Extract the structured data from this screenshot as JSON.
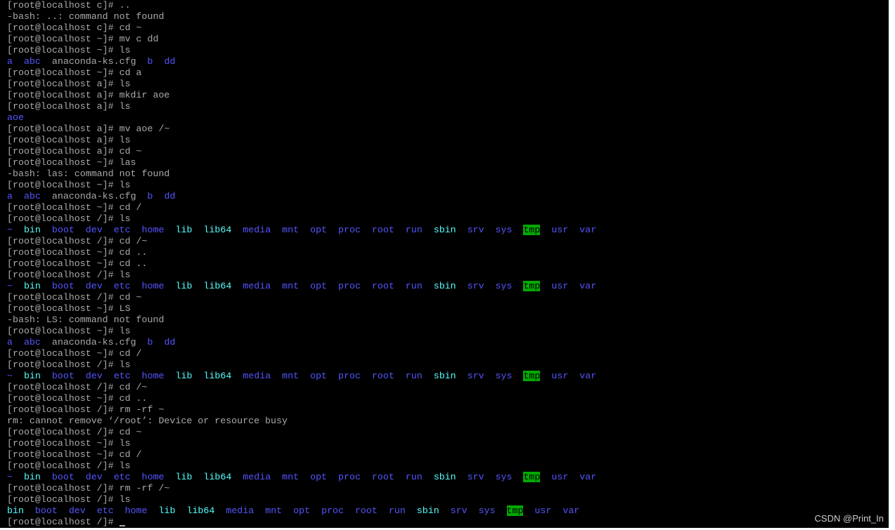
{
  "terminal": {
    "colors": {
      "background": "#000000",
      "text": "#aaaaaa",
      "directory": "#5555ff",
      "directory_highlight": "#55ffff",
      "sticky_dir_bg": "#00aa00"
    },
    "lines": [
      [
        {
          "t": "[root@localhost c]# .."
        }
      ],
      [
        {
          "t": "-bash: ..: command not found"
        }
      ],
      [
        {
          "t": "[root@localhost c]# cd ~"
        }
      ],
      [
        {
          "t": "[root@localhost ~]# mv c dd"
        }
      ],
      [
        {
          "t": "[root@localhost ~]# ls"
        }
      ],
      [
        {
          "t": "a",
          "c": "dir"
        },
        {
          "t": "  "
        },
        {
          "t": "abc",
          "c": "dir"
        },
        {
          "t": "  anaconda-ks.cfg  "
        },
        {
          "t": "b",
          "c": "dir"
        },
        {
          "t": "  "
        },
        {
          "t": "dd",
          "c": "dir"
        }
      ],
      [
        {
          "t": "[root@localhost ~]# cd a"
        }
      ],
      [
        {
          "t": "[root@localhost a]# ls"
        }
      ],
      [
        {
          "t": "[root@localhost a]# mkdir aoe"
        }
      ],
      [
        {
          "t": "[root@localhost a]# ls"
        }
      ],
      [
        {
          "t": "aoe",
          "c": "dir"
        }
      ],
      [
        {
          "t": "[root@localhost a]# mv aoe /~"
        }
      ],
      [
        {
          "t": "[root@localhost a]# ls"
        }
      ],
      [
        {
          "t": "[root@localhost a]# cd ~"
        }
      ],
      [
        {
          "t": "[root@localhost ~]# las"
        }
      ],
      [
        {
          "t": "-bash: las: command not found"
        }
      ],
      [
        {
          "t": "[root@localhost ~]# ls"
        }
      ],
      [
        {
          "t": "a",
          "c": "dir"
        },
        {
          "t": "  "
        },
        {
          "t": "abc",
          "c": "dir"
        },
        {
          "t": "  anaconda-ks.cfg  "
        },
        {
          "t": "b",
          "c": "dir"
        },
        {
          "t": "  "
        },
        {
          "t": "dd",
          "c": "dir"
        }
      ],
      [
        {
          "t": "[root@localhost ~]# cd /"
        }
      ],
      [
        {
          "t": "[root@localhost /]# ls"
        }
      ],
      [
        {
          "t": "~",
          "c": "dir"
        },
        {
          "t": "  "
        },
        {
          "t": "bin",
          "c": "dir-hl"
        },
        {
          "t": "  "
        },
        {
          "t": "boot",
          "c": "dir"
        },
        {
          "t": "  "
        },
        {
          "t": "dev",
          "c": "dir"
        },
        {
          "t": "  "
        },
        {
          "t": "etc",
          "c": "dir"
        },
        {
          "t": "  "
        },
        {
          "t": "home",
          "c": "dir"
        },
        {
          "t": "  "
        },
        {
          "t": "lib",
          "c": "dir-hl"
        },
        {
          "t": "  "
        },
        {
          "t": "lib64",
          "c": "dir-hl"
        },
        {
          "t": "  "
        },
        {
          "t": "media",
          "c": "dir"
        },
        {
          "t": "  "
        },
        {
          "t": "mnt",
          "c": "dir"
        },
        {
          "t": "  "
        },
        {
          "t": "opt",
          "c": "dir"
        },
        {
          "t": "  "
        },
        {
          "t": "proc",
          "c": "dir"
        },
        {
          "t": "  "
        },
        {
          "t": "root",
          "c": "dir"
        },
        {
          "t": "  "
        },
        {
          "t": "run",
          "c": "dir"
        },
        {
          "t": "  "
        },
        {
          "t": "sbin",
          "c": "dir-hl"
        },
        {
          "t": "  "
        },
        {
          "t": "srv",
          "c": "dir"
        },
        {
          "t": "  "
        },
        {
          "t": "sys",
          "c": "dir"
        },
        {
          "t": "  "
        },
        {
          "t": "tmp",
          "c": "tmp-dir"
        },
        {
          "t": "  "
        },
        {
          "t": "usr",
          "c": "dir"
        },
        {
          "t": "  "
        },
        {
          "t": "var",
          "c": "dir"
        }
      ],
      [
        {
          "t": "[root@localhost /]# cd /~"
        }
      ],
      [
        {
          "t": "[root@localhost ~]# cd .."
        }
      ],
      [
        {
          "t": "[root@localhost ~]# cd .."
        }
      ],
      [
        {
          "t": "[root@localhost /]# ls"
        }
      ],
      [
        {
          "t": "~",
          "c": "dir"
        },
        {
          "t": "  "
        },
        {
          "t": "bin",
          "c": "dir-hl"
        },
        {
          "t": "  "
        },
        {
          "t": "boot",
          "c": "dir"
        },
        {
          "t": "  "
        },
        {
          "t": "dev",
          "c": "dir"
        },
        {
          "t": "  "
        },
        {
          "t": "etc",
          "c": "dir"
        },
        {
          "t": "  "
        },
        {
          "t": "home",
          "c": "dir"
        },
        {
          "t": "  "
        },
        {
          "t": "lib",
          "c": "dir-hl"
        },
        {
          "t": "  "
        },
        {
          "t": "lib64",
          "c": "dir-hl"
        },
        {
          "t": "  "
        },
        {
          "t": "media",
          "c": "dir"
        },
        {
          "t": "  "
        },
        {
          "t": "mnt",
          "c": "dir"
        },
        {
          "t": "  "
        },
        {
          "t": "opt",
          "c": "dir"
        },
        {
          "t": "  "
        },
        {
          "t": "proc",
          "c": "dir"
        },
        {
          "t": "  "
        },
        {
          "t": "root",
          "c": "dir"
        },
        {
          "t": "  "
        },
        {
          "t": "run",
          "c": "dir"
        },
        {
          "t": "  "
        },
        {
          "t": "sbin",
          "c": "dir-hl"
        },
        {
          "t": "  "
        },
        {
          "t": "srv",
          "c": "dir"
        },
        {
          "t": "  "
        },
        {
          "t": "sys",
          "c": "dir"
        },
        {
          "t": "  "
        },
        {
          "t": "tmp",
          "c": "tmp-dir"
        },
        {
          "t": "  "
        },
        {
          "t": "usr",
          "c": "dir"
        },
        {
          "t": "  "
        },
        {
          "t": "var",
          "c": "dir"
        }
      ],
      [
        {
          "t": "[root@localhost /]# cd ~"
        }
      ],
      [
        {
          "t": "[root@localhost ~]# LS"
        }
      ],
      [
        {
          "t": "-bash: LS: command not found"
        }
      ],
      [
        {
          "t": "[root@localhost ~]# ls"
        }
      ],
      [
        {
          "t": "a",
          "c": "dir"
        },
        {
          "t": "  "
        },
        {
          "t": "abc",
          "c": "dir"
        },
        {
          "t": "  anaconda-ks.cfg  "
        },
        {
          "t": "b",
          "c": "dir"
        },
        {
          "t": "  "
        },
        {
          "t": "dd",
          "c": "dir"
        }
      ],
      [
        {
          "t": "[root@localhost ~]# cd /"
        }
      ],
      [
        {
          "t": "[root@localhost /]# ls"
        }
      ],
      [
        {
          "t": "~",
          "c": "dir"
        },
        {
          "t": "  "
        },
        {
          "t": "bin",
          "c": "dir-hl"
        },
        {
          "t": "  "
        },
        {
          "t": "boot",
          "c": "dir"
        },
        {
          "t": "  "
        },
        {
          "t": "dev",
          "c": "dir"
        },
        {
          "t": "  "
        },
        {
          "t": "etc",
          "c": "dir"
        },
        {
          "t": "  "
        },
        {
          "t": "home",
          "c": "dir"
        },
        {
          "t": "  "
        },
        {
          "t": "lib",
          "c": "dir-hl"
        },
        {
          "t": "  "
        },
        {
          "t": "lib64",
          "c": "dir-hl"
        },
        {
          "t": "  "
        },
        {
          "t": "media",
          "c": "dir"
        },
        {
          "t": "  "
        },
        {
          "t": "mnt",
          "c": "dir"
        },
        {
          "t": "  "
        },
        {
          "t": "opt",
          "c": "dir"
        },
        {
          "t": "  "
        },
        {
          "t": "proc",
          "c": "dir"
        },
        {
          "t": "  "
        },
        {
          "t": "root",
          "c": "dir"
        },
        {
          "t": "  "
        },
        {
          "t": "run",
          "c": "dir"
        },
        {
          "t": "  "
        },
        {
          "t": "sbin",
          "c": "dir-hl"
        },
        {
          "t": "  "
        },
        {
          "t": "srv",
          "c": "dir"
        },
        {
          "t": "  "
        },
        {
          "t": "sys",
          "c": "dir"
        },
        {
          "t": "  "
        },
        {
          "t": "tmp",
          "c": "tmp-dir"
        },
        {
          "t": "  "
        },
        {
          "t": "usr",
          "c": "dir"
        },
        {
          "t": "  "
        },
        {
          "t": "var",
          "c": "dir"
        }
      ],
      [
        {
          "t": "[root@localhost /]# cd /~"
        }
      ],
      [
        {
          "t": "[root@localhost ~]# cd .."
        }
      ],
      [
        {
          "t": "[root@localhost /]# rm -rf ~"
        }
      ],
      [
        {
          "t": "rm: cannot remove ‘/root’: Device or resource busy"
        }
      ],
      [
        {
          "t": "[root@localhost /]# cd ~"
        }
      ],
      [
        {
          "t": "[root@localhost ~]# ls"
        }
      ],
      [
        {
          "t": "[root@localhost ~]# cd /"
        }
      ],
      [
        {
          "t": "[root@localhost /]# ls"
        }
      ],
      [
        {
          "t": "~",
          "c": "dir"
        },
        {
          "t": "  "
        },
        {
          "t": "bin",
          "c": "dir-hl"
        },
        {
          "t": "  "
        },
        {
          "t": "boot",
          "c": "dir"
        },
        {
          "t": "  "
        },
        {
          "t": "dev",
          "c": "dir"
        },
        {
          "t": "  "
        },
        {
          "t": "etc",
          "c": "dir"
        },
        {
          "t": "  "
        },
        {
          "t": "home",
          "c": "dir"
        },
        {
          "t": "  "
        },
        {
          "t": "lib",
          "c": "dir-hl"
        },
        {
          "t": "  "
        },
        {
          "t": "lib64",
          "c": "dir-hl"
        },
        {
          "t": "  "
        },
        {
          "t": "media",
          "c": "dir"
        },
        {
          "t": "  "
        },
        {
          "t": "mnt",
          "c": "dir"
        },
        {
          "t": "  "
        },
        {
          "t": "opt",
          "c": "dir"
        },
        {
          "t": "  "
        },
        {
          "t": "proc",
          "c": "dir"
        },
        {
          "t": "  "
        },
        {
          "t": "root",
          "c": "dir"
        },
        {
          "t": "  "
        },
        {
          "t": "run",
          "c": "dir"
        },
        {
          "t": "  "
        },
        {
          "t": "sbin",
          "c": "dir-hl"
        },
        {
          "t": "  "
        },
        {
          "t": "srv",
          "c": "dir"
        },
        {
          "t": "  "
        },
        {
          "t": "sys",
          "c": "dir"
        },
        {
          "t": "  "
        },
        {
          "t": "tmp",
          "c": "tmp-dir"
        },
        {
          "t": "  "
        },
        {
          "t": "usr",
          "c": "dir"
        },
        {
          "t": "  "
        },
        {
          "t": "var",
          "c": "dir"
        }
      ],
      [
        {
          "t": "[root@localhost /]# rm -rf /~"
        }
      ],
      [
        {
          "t": "[root@localhost /]# ls"
        }
      ],
      [
        {
          "t": "bin",
          "c": "dir-hl"
        },
        {
          "t": "  "
        },
        {
          "t": "boot",
          "c": "dir"
        },
        {
          "t": "  "
        },
        {
          "t": "dev",
          "c": "dir"
        },
        {
          "t": "  "
        },
        {
          "t": "etc",
          "c": "dir"
        },
        {
          "t": "  "
        },
        {
          "t": "home",
          "c": "dir"
        },
        {
          "t": "  "
        },
        {
          "t": "lib",
          "c": "dir-hl"
        },
        {
          "t": "  "
        },
        {
          "t": "lib64",
          "c": "dir-hl"
        },
        {
          "t": "  "
        },
        {
          "t": "media",
          "c": "dir"
        },
        {
          "t": "  "
        },
        {
          "t": "mnt",
          "c": "dir"
        },
        {
          "t": "  "
        },
        {
          "t": "opt",
          "c": "dir"
        },
        {
          "t": "  "
        },
        {
          "t": "proc",
          "c": "dir"
        },
        {
          "t": "  "
        },
        {
          "t": "root",
          "c": "dir"
        },
        {
          "t": "  "
        },
        {
          "t": "run",
          "c": "dir"
        },
        {
          "t": "  "
        },
        {
          "t": "sbin",
          "c": "dir-hl"
        },
        {
          "t": "  "
        },
        {
          "t": "srv",
          "c": "dir"
        },
        {
          "t": "  "
        },
        {
          "t": "sys",
          "c": "dir"
        },
        {
          "t": "  "
        },
        {
          "t": "tmp",
          "c": "tmp-dir"
        },
        {
          "t": "  "
        },
        {
          "t": "usr",
          "c": "dir"
        },
        {
          "t": "  "
        },
        {
          "t": "var",
          "c": "dir"
        }
      ],
      [
        {
          "t": "[root@localhost /]# "
        },
        {
          "t": "",
          "c": "cursor"
        }
      ]
    ]
  },
  "watermark": {
    "text": "CSDN @Print_In"
  }
}
